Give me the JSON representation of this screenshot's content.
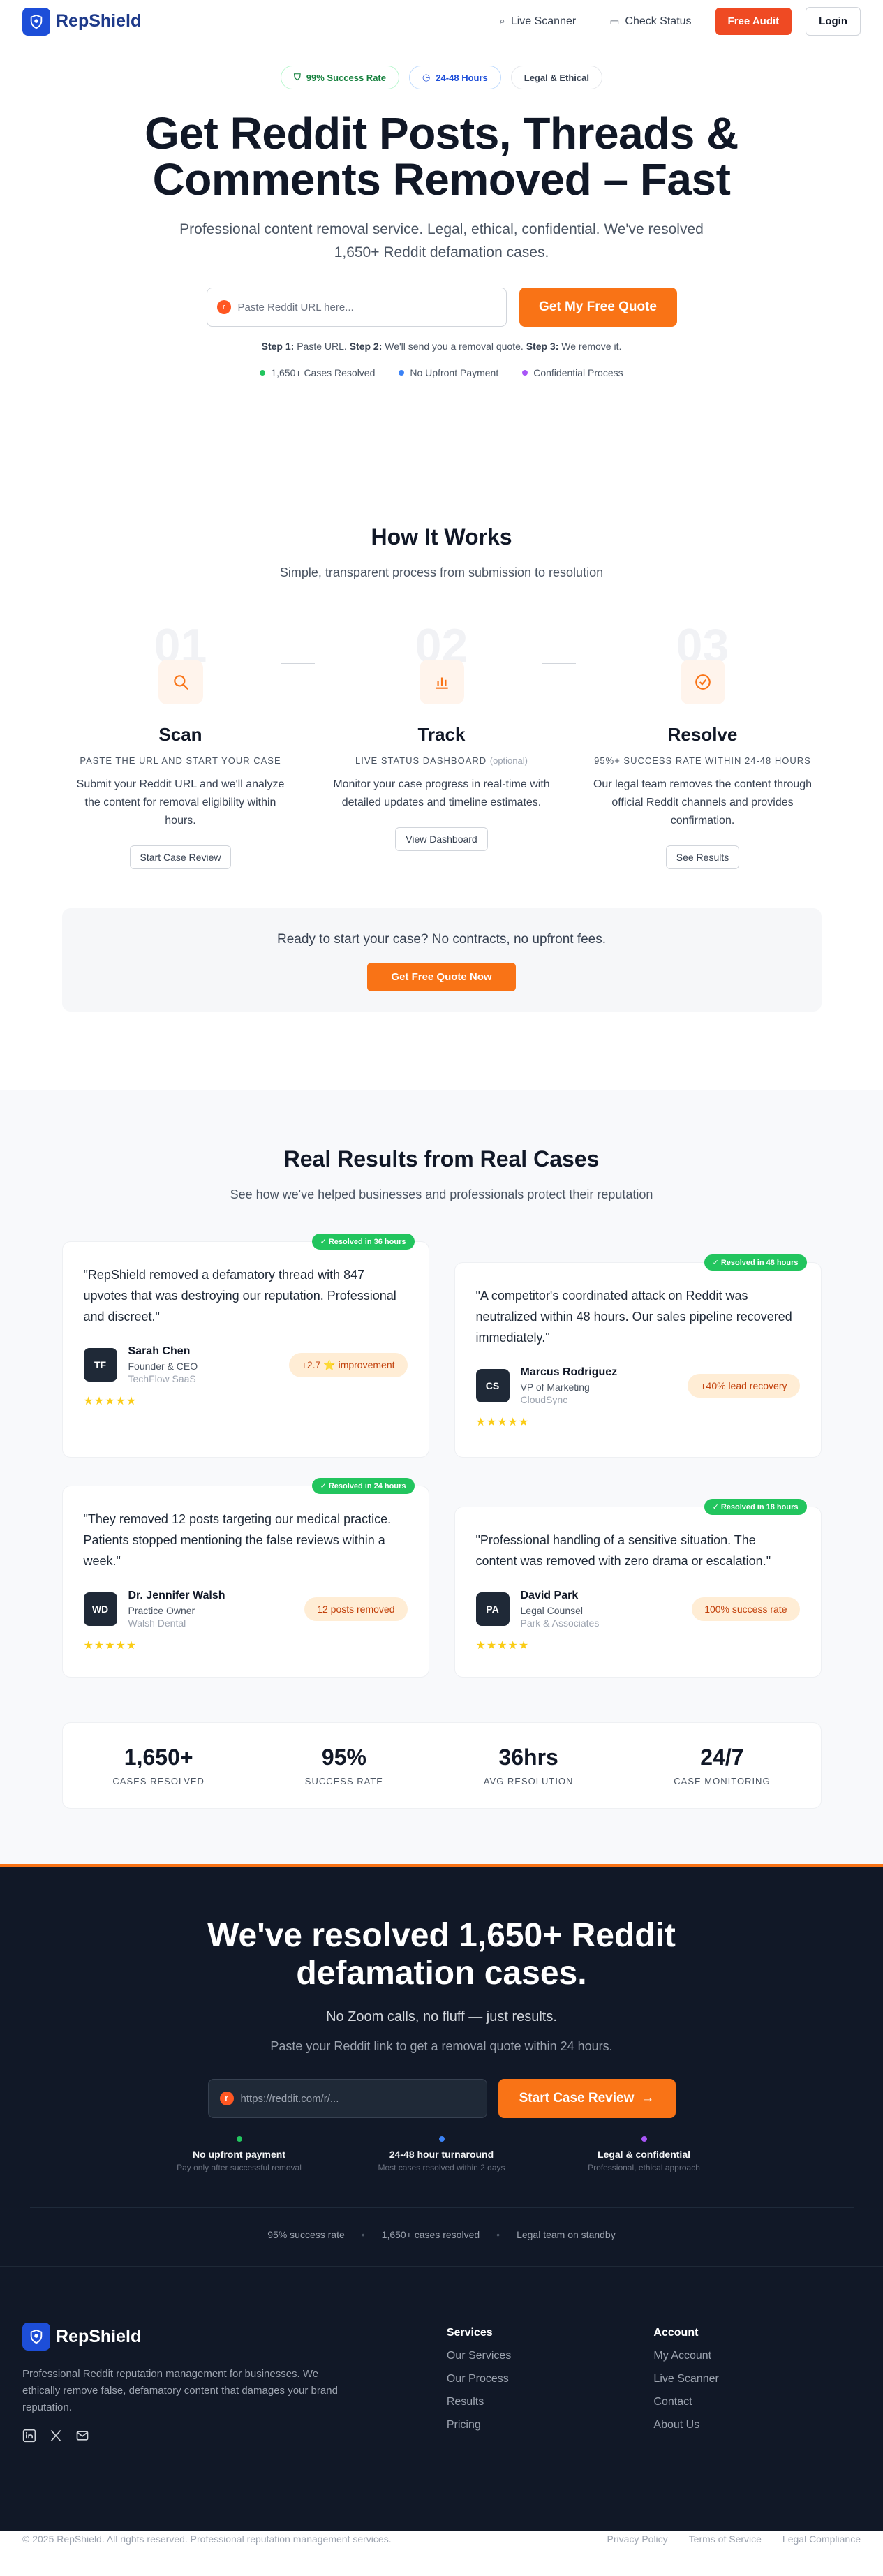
{
  "nav": {
    "brand": "RepShield",
    "live_scanner": "Live Scanner",
    "check_status": "Check Status",
    "free_audit": "Free Audit",
    "login": "Login"
  },
  "hero": {
    "badges": [
      "99% Success Rate",
      "24-48 Hours",
      "Legal & Ethical"
    ],
    "title": "Get Reddit Posts, Threads & Comments Removed – Fast",
    "subtitle": "Professional content removal service. Legal, ethical, confidential. We've resolved 1,650+ Reddit defamation cases.",
    "input_placeholder": "Paste Reddit URL here...",
    "cta": "Get My Free Quote",
    "steps": [
      {
        "label": "Step 1:",
        "text": "Paste URL."
      },
      {
        "label": "Step 2:",
        "text": "We'll send you a removal quote."
      },
      {
        "label": "Step 3:",
        "text": "We remove it."
      }
    ],
    "trust": [
      "1,650+ Cases Resolved",
      "No Upfront Payment",
      "Confidential Process"
    ],
    "trust_colors": [
      "#22c55e",
      "#3b82f6",
      "#a855f7"
    ]
  },
  "how": {
    "title": "How It Works",
    "subtitle": "Simple, transparent process from submission to resolution",
    "steps": [
      {
        "num": "01",
        "title": "Scan",
        "tag": "PASTE THE URL AND START YOUR CASE",
        "tag_opt": "",
        "desc": "Submit your Reddit URL and we'll analyze the content for removal eligibility within hours.",
        "button": "Start Case Review",
        "icon": "search-icon"
      },
      {
        "num": "02",
        "title": "Track",
        "tag": "LIVE STATUS DASHBOARD",
        "tag_opt": "(optional)",
        "desc": "Monitor your case progress in real-time with detailed updates and timeline estimates.",
        "button": "View Dashboard",
        "icon": "chart-icon"
      },
      {
        "num": "03",
        "title": "Resolve",
        "tag": "95%+ SUCCESS RATE WITHIN 24-48 HOURS",
        "tag_opt": "",
        "desc": "Our legal team removes the content through official Reddit channels and provides confirmation.",
        "button": "See Results",
        "icon": "check-circle-icon"
      }
    ],
    "cta_text": "Ready to start your case? No contracts, no upfront fees.",
    "cta_button": "Get Free Quote Now"
  },
  "results": {
    "title": "Real Results from Real Cases",
    "subtitle": "See how we've helped businesses and professionals protect their reputation",
    "cards": [
      {
        "badge": "Resolved in 36 hours",
        "quote": "\"RepShield removed a defamatory thread with 847 upvotes that was destroying our reputation. Professional and discreet.\"",
        "initials": "TF",
        "name": "Sarah Chen",
        "role": "Founder & CEO",
        "company": "TechFlow SaaS",
        "metric": "+2.7 ⭐ improvement",
        "stars": "★★★★★"
      },
      {
        "badge": "Resolved in 48 hours",
        "quote": "\"A competitor's coordinated attack on Reddit was neutralized within 48 hours. Our sales pipeline recovered immediately.\"",
        "initials": "CS",
        "name": "Marcus Rodriguez",
        "role": "VP of Marketing",
        "company": "CloudSync",
        "metric": "+40% lead recovery",
        "stars": "★★★★★"
      },
      {
        "badge": "Resolved in 24 hours",
        "quote": "\"They removed 12 posts targeting our medical practice. Patients stopped mentioning the false reviews within a week.\"",
        "initials": "WD",
        "name": "Dr. Jennifer Walsh",
        "role": "Practice Owner",
        "company": "Walsh Dental",
        "metric": "12 posts removed",
        "stars": "★★★★★"
      },
      {
        "badge": "Resolved in 18 hours",
        "quote": "\"Professional handling of a sensitive situation. The content was removed with zero drama or escalation.\"",
        "initials": "PA",
        "name": "David Park",
        "role": "Legal Counsel",
        "company": "Park & Associates",
        "metric": "100% success rate",
        "stars": "★★★★★"
      }
    ],
    "stats": [
      {
        "value": "1,650+",
        "label": "CASES RESOLVED"
      },
      {
        "value": "95%",
        "label": "SUCCESS RATE"
      },
      {
        "value": "36hrs",
        "label": "AVG RESOLUTION"
      },
      {
        "value": "24/7",
        "label": "CASE MONITORING"
      }
    ]
  },
  "dark_cta": {
    "title": "We've resolved 1,650+ Reddit defamation cases.",
    "line1": "No Zoom calls, no fluff — just results.",
    "line2": "Paste your Reddit link to get a removal quote within 24 hours.",
    "placeholder": "https://reddit.com/r/...",
    "button": "Start Case Review",
    "features": [
      {
        "title": "No upfront payment",
        "sub": "Pay only after successful removal",
        "color": "#22c55e"
      },
      {
        "title": "24-48 hour turnaround",
        "sub": "Most cases resolved within 2 days",
        "color": "#3b82f6"
      },
      {
        "title": "Legal & confidential",
        "sub": "Professional, ethical approach",
        "color": "#a855f7"
      }
    ],
    "mini": [
      "95% success rate",
      "1,650+ cases resolved",
      "Legal team on standby"
    ]
  },
  "footer": {
    "brand": "RepShield",
    "description": "Professional Reddit reputation management for businesses. We ethically remove false, defamatory content that damages your brand reputation.",
    "services_title": "Services",
    "services": [
      "Our Services",
      "Our Process",
      "Results",
      "Pricing"
    ],
    "account_title": "Account",
    "account": [
      "My Account",
      "Live Scanner",
      "Contact",
      "About Us"
    ],
    "copyright": "© 2025 RepShield. All rights reserved. Professional reputation management services.",
    "legal_links": [
      "Privacy Policy",
      "Terms of Service",
      "Legal Compliance"
    ]
  }
}
